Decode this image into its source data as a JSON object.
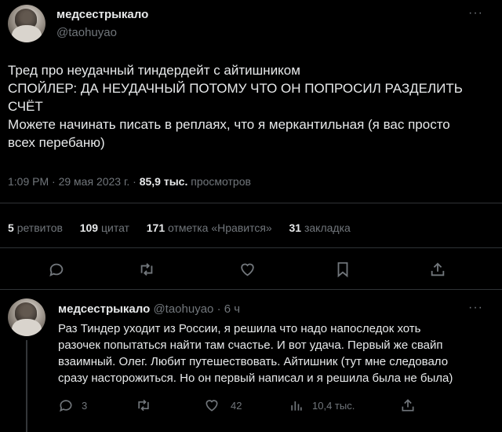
{
  "tweet": {
    "author_name": "медсестрыкало",
    "author_handle": "@taohuyao",
    "text_lines": [
      "Тред про неудачный тиндердейт с айтишником",
      "СПОЙЛЕР: ДА НЕУДАЧНЫЙ ПОТОМУ ЧТО ОН ПОПРОСИЛ РАЗДЕЛИТЬ",
      "СЧЁТ",
      "Можете начинать писать в реплаях, что я меркантильная (я вас просто",
      "всех перебаню)"
    ],
    "time": "1:09 PM",
    "date": "29 мая 2023 г.",
    "separator": "·",
    "views_count": "85,9 тыс.",
    "views_label": "просмотров",
    "stats": {
      "retweets_count": "5",
      "retweets_label": "ретвитов",
      "quotes_count": "109",
      "quotes_label": "цитат",
      "likes_count": "171",
      "likes_label": "отметка «Нравится»",
      "bookmarks_count": "31",
      "bookmarks_label": "закладка"
    },
    "more_glyph": "···"
  },
  "reply": {
    "author_name": "медсестрыкало",
    "author_handle": "@taohuyao",
    "separator": "·",
    "time_ago": "6 ч",
    "text_lines": [
      "Раз Тиндер уходит из России, я решила что надо напоследок хоть",
      "разочек попытаться найти там счастье. И вот удача. Первый же свайп",
      "взаимный. Олег. Любит путешествовать. Айтишник (тут мне следовало",
      "сразу насторожиться. Но он первый написал и я решила была не была)"
    ],
    "replies_count": "3",
    "likes_count": "42",
    "views_count": "10,4 тыс.",
    "more_glyph": "···"
  },
  "colors": {
    "background": "#000000",
    "text": "#e7e9ea",
    "muted": "#71767b",
    "divider": "#2f3336"
  }
}
